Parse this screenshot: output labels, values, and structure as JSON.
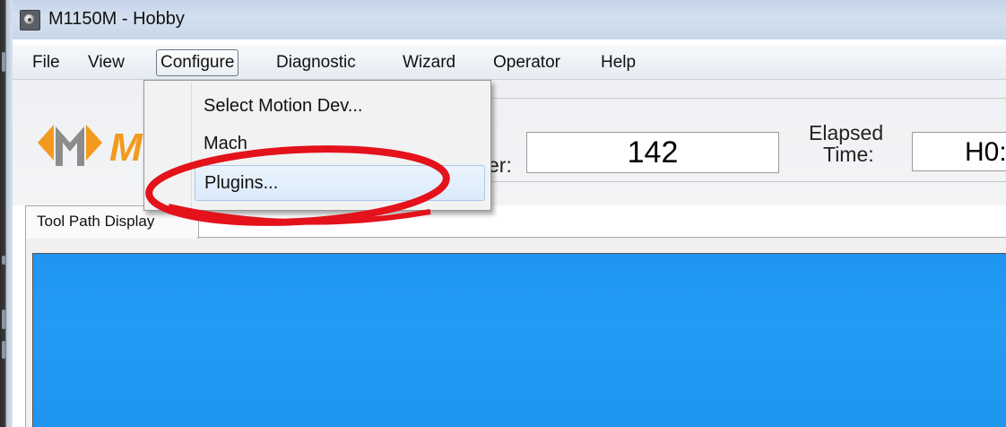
{
  "window": {
    "title": "M1150M - Hobby",
    "icon": "app-icon"
  },
  "menubar": {
    "items": [
      {
        "label": "File"
      },
      {
        "label": "View"
      },
      {
        "label": "Configure",
        "open": true
      },
      {
        "label": "Diagnostic"
      },
      {
        "label": "Wizard"
      },
      {
        "label": "Operator"
      },
      {
        "label": "Help"
      }
    ]
  },
  "configure_menu": {
    "items": [
      {
        "label": "Select Motion Dev..."
      },
      {
        "label": "Mach"
      },
      {
        "label": "Plugins...",
        "highlighted": true
      }
    ],
    "annotation_color": "#e3121b"
  },
  "toolbar": {
    "logo_letter_1": "M",
    "logo_letter_2": "M",
    "counter_label_tail": "er:",
    "counter_value": "142",
    "elapsed_label_line1": "Elapsed",
    "elapsed_label_line2": "Time:",
    "elapsed_value": "H0:"
  },
  "tabs": [
    {
      "label": "Tool Path Display",
      "active": true
    }
  ],
  "colors": {
    "display_background": "#1f95f2",
    "accent_orange": "#f39a1e",
    "logo_gray": "#8c8c8c"
  }
}
